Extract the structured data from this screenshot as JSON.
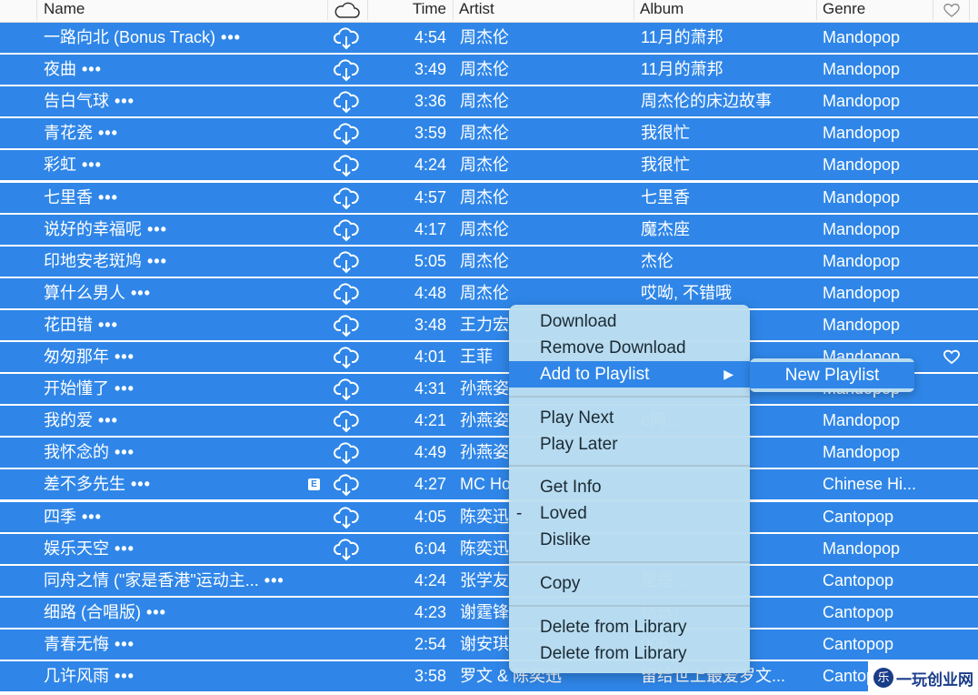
{
  "columns": {
    "name": "Name",
    "cloud_icon": "cloud-icon",
    "time": "Time",
    "artist": "Artist",
    "album": "Album",
    "genre": "Genre",
    "loved_icon": "heart-icon"
  },
  "rows": [
    {
      "name": "一路向北 (Bonus Track)",
      "more": "•••",
      "cloud": true,
      "time": "4:54",
      "artist": "周杰伦",
      "album": "11月的萧邦",
      "genre": "Mandopop"
    },
    {
      "name": "夜曲",
      "more": "•••",
      "cloud": true,
      "time": "3:49",
      "artist": "周杰伦",
      "album": "11月的萧邦",
      "genre": "Mandopop"
    },
    {
      "name": "告白气球",
      "more": "•••",
      "cloud": true,
      "time": "3:36",
      "artist": "周杰伦",
      "album": "周杰伦的床边故事",
      "genre": "Mandopop"
    },
    {
      "name": "青花瓷",
      "more": "•••",
      "cloud": true,
      "time": "3:59",
      "artist": "周杰伦",
      "album": "我很忙",
      "genre": "Mandopop"
    },
    {
      "name": "彩虹",
      "more": "•••",
      "cloud": true,
      "time": "4:24",
      "artist": "周杰伦",
      "album": "我很忙",
      "genre": "Mandopop"
    },
    {
      "name": "七里香",
      "more": "•••",
      "cloud": true,
      "time": "4:57",
      "artist": "周杰伦",
      "album": "七里香",
      "genre": "Mandopop"
    },
    {
      "name": "说好的幸福呢",
      "more": "•••",
      "cloud": true,
      "time": "4:17",
      "artist": "周杰伦",
      "album": "魔杰座",
      "genre": "Mandopop"
    },
    {
      "name": "印地安老斑鸠",
      "more": "•••",
      "cloud": true,
      "time": "5:05",
      "artist": "周杰伦",
      "album": "杰伦",
      "genre": "Mandopop"
    },
    {
      "name": "算什么男人",
      "more": "•••",
      "cloud": true,
      "time": "4:48",
      "artist": "周杰伦",
      "album": "哎呦, 不错哦",
      "genre": "Mandopop"
    },
    {
      "name": "花田错",
      "more": "•••",
      "cloud": true,
      "time": "3:48",
      "artist": "王力宏",
      "album": "",
      "genre": "Mandopop"
    },
    {
      "name": "匆匆那年",
      "more": "•••",
      "cloud": true,
      "time": "4:01",
      "artist": "王菲",
      "album": "",
      "genre": "Mandopop",
      "loved": true
    },
    {
      "name": "开始懂了",
      "more": "•••",
      "cloud": true,
      "time": "4:31",
      "artist": "孙燕姿",
      "album": "",
      "genre": "Mandopop"
    },
    {
      "name": "我的爱",
      "more": "•••",
      "cloud": true,
      "time": "4:21",
      "artist": "孙燕姿",
      "album": "e同...",
      "genre": "Mandopop"
    },
    {
      "name": "我怀念的",
      "more": "•••",
      "cloud": true,
      "time": "4:49",
      "artist": "孙燕姿",
      "album": "",
      "genre": "Mandopop"
    },
    {
      "name": "差不多先生",
      "more": "•••",
      "cloud": true,
      "explicit": "E",
      "time": "4:27",
      "artist": "MC Ho",
      "album": "",
      "genre": "Chinese Hi..."
    },
    {
      "name": "四季",
      "more": "•••",
      "cloud": true,
      "time": "4:05",
      "artist": "陈奕迅",
      "album": "",
      "genre": "Cantopop"
    },
    {
      "name": "娱乐天空",
      "more": "•••",
      "cloud": true,
      "time": "6:04",
      "artist": "陈奕迅",
      "album": "",
      "genre": "Mandopop"
    },
    {
      "name": "同舟之情 (\"家是香港\"运动主...",
      "more": "•••",
      "cloud": false,
      "time": "4:24",
      "artist": "张学友",
      "album": "是香...",
      "genre": "Cantopop"
    },
    {
      "name": "细路 (合唱版)",
      "more": "•••",
      "cloud": false,
      "time": "4:23",
      "artist": "谢霆锋",
      "album": "精选)",
      "genre": "Cantopop"
    },
    {
      "name": "青春无悔",
      "more": "•••",
      "cloud": false,
      "time": "2:54",
      "artist": "谢安琪",
      "album": "006-...",
      "genre": "Cantopop"
    },
    {
      "name": "几许风雨",
      "more": "•••",
      "cloud": false,
      "time": "3:58",
      "artist": "罗文 & 陈奕迅",
      "album": "留给世上最爱罗文...",
      "genre": "Cantopop"
    }
  ],
  "context_menu": {
    "items": [
      {
        "label": "Download"
      },
      {
        "label": "Remove Download"
      },
      {
        "label": "Add to Playlist",
        "submenu_arrow": "▶",
        "selected": true
      },
      {
        "label": "Play Next"
      },
      {
        "label": "Play Later"
      },
      {
        "label": "Get Info"
      },
      {
        "label": "Loved",
        "check": "-"
      },
      {
        "label": "Dislike"
      },
      {
        "label": "Copy"
      },
      {
        "label": "Delete from Library"
      },
      {
        "label": "Delete from Library"
      }
    ]
  },
  "submenu": {
    "items": [
      {
        "label": "New Playlist",
        "selected": true
      }
    ]
  },
  "watermark": {
    "logo": "乐",
    "text": "一玩创业网"
  },
  "colors": {
    "selection": "#2f86e8",
    "menu_bg": "#bcdef0",
    "header_bg": "#fafafa"
  }
}
